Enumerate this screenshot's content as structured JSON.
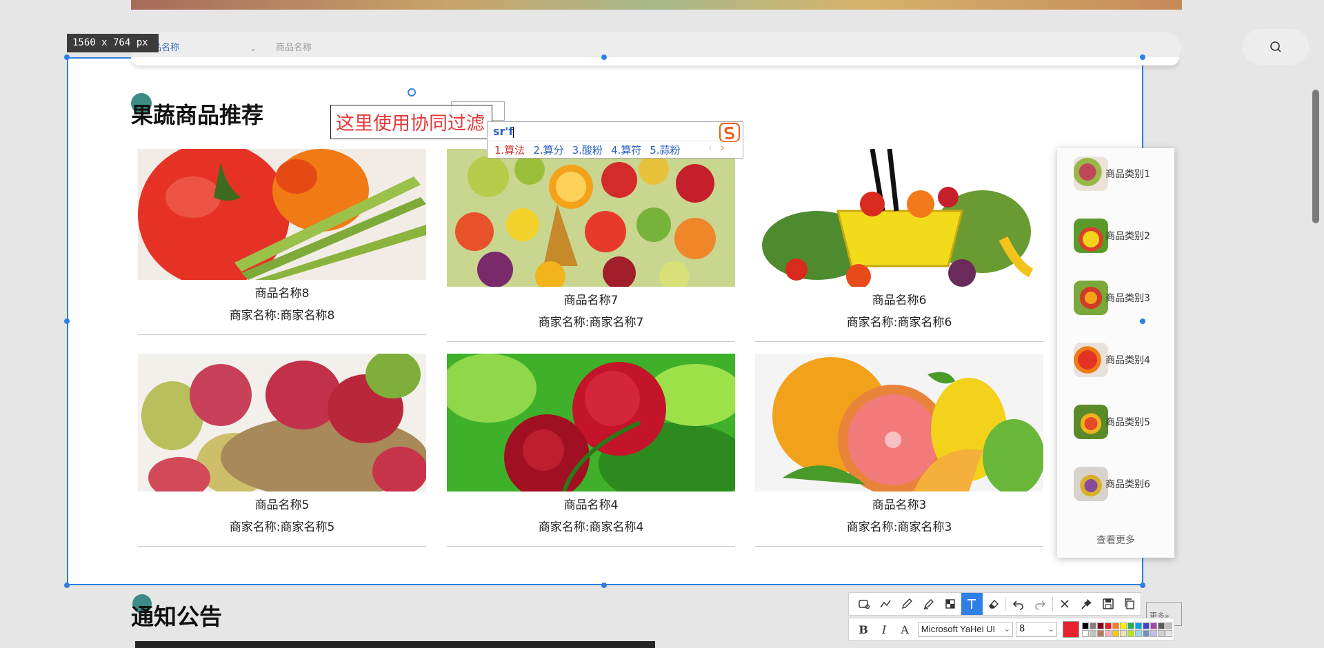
{
  "background": {
    "search": {
      "select_value": "商品名称",
      "placeholder": "商品名称"
    },
    "notice_title": "通知公告",
    "more_link_partial": "更多»"
  },
  "capture": {
    "size_label": "1560 x 764  px"
  },
  "section": {
    "title": "果蔬商品推荐"
  },
  "products": [
    {
      "name": "商品名称8",
      "merchant": "商家名称:商家名称8",
      "image": "peppers-asparagus"
    },
    {
      "name": "商品名称7",
      "merchant": "商家名称:商家名称7",
      "image": "mixed-fruit-pile"
    },
    {
      "name": "商品名称6",
      "merchant": "商家名称:商家名称6",
      "image": "yellow-basket-vegetables"
    },
    {
      "name": "商品名称5",
      "merchant": "商家名称:商家名称5",
      "image": "pomegranates-basket"
    },
    {
      "name": "商品名称4",
      "merchant": "商家名称:商家名称4",
      "image": "bayberries-leaves"
    },
    {
      "name": "商品名称3",
      "merchant": "商家名称:商家名称3",
      "image": "grapefruit-citrus"
    }
  ],
  "sidebar": {
    "categories": [
      {
        "label": "商品类别1",
        "thumb_color": "#b84a5a"
      },
      {
        "label": "商品类别2",
        "thumb_color": "#d9a62b"
      },
      {
        "label": "商品类别3",
        "thumb_color": "#c85a2a"
      },
      {
        "label": "商品类别4",
        "thumb_color": "#d6492e"
      },
      {
        "label": "商品类别5",
        "thumb_color": "#8c9a3a"
      },
      {
        "label": "商品类别6",
        "thumb_color": "#8a5a6a"
      }
    ],
    "more": "查看更多"
  },
  "annotation": {
    "text": "这里使用协同过滤",
    "ghost_text": "查看更多"
  },
  "ime": {
    "input": "sr'f",
    "candidates": [
      "1.算法",
      "2.算分",
      "3.酸粉",
      "4.算符",
      "5.蒜粉"
    ]
  },
  "toolbar": {
    "tools": [
      "rectangle-icon",
      "polyline-icon",
      "pen-icon",
      "marker-icon",
      "mosaic-icon",
      "text-icon",
      "eraser-icon",
      "undo-icon",
      "redo-icon",
      "close-icon",
      "pin-icon",
      "save-icon",
      "copy-icon"
    ],
    "font": "Microsoft YaHei UI",
    "font_size": "8",
    "current_color": "#e8212e",
    "palette": [
      "#000000",
      "#7f7f7f",
      "#880015",
      "#ed1c24",
      "#ff7f27",
      "#fff200",
      "#22b14c",
      "#00a2e8",
      "#3f48cc",
      "#a349a4",
      "#5a5a5a",
      "#c0c0c0",
      "#ffffff",
      "#c3c3c3",
      "#b97a57",
      "#ffaec9",
      "#ffc90e",
      "#efe4b0",
      "#b5e61d",
      "#99d9ea",
      "#7092be",
      "#c8bfe7",
      "#d0d0d0",
      "#e6e6e6"
    ]
  }
}
